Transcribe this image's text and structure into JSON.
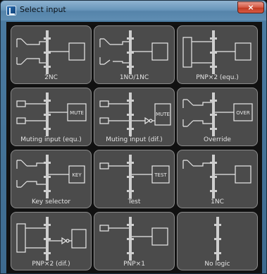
{
  "window": {
    "title": "Select input",
    "close_label": "×"
  },
  "tiles": [
    {
      "label": "2NC"
    },
    {
      "label": "1NO/1NC"
    },
    {
      "label": "PNP×2 (equ.)"
    },
    {
      "label": "Muting input (equ.)",
      "box_text": "MUTE"
    },
    {
      "label": "Muting input (dif.)",
      "box_text": "MUTE"
    },
    {
      "label": "Override",
      "box_text": "OVER"
    },
    {
      "label": "Key selector",
      "box_text": "KEY"
    },
    {
      "label": "Test",
      "box_text": "TEST"
    },
    {
      "label": "1NC"
    },
    {
      "label": "PNP×2 (dif.)"
    },
    {
      "label": "PNP×1"
    },
    {
      "label": "No logic"
    }
  ],
  "colors": {
    "tile_background": "#4b4b4b",
    "tile_border": "#8a8a8a",
    "diagram_line": "#e8e8e8",
    "title_bar": "#6a97bb",
    "close_button": "#c13b23"
  }
}
